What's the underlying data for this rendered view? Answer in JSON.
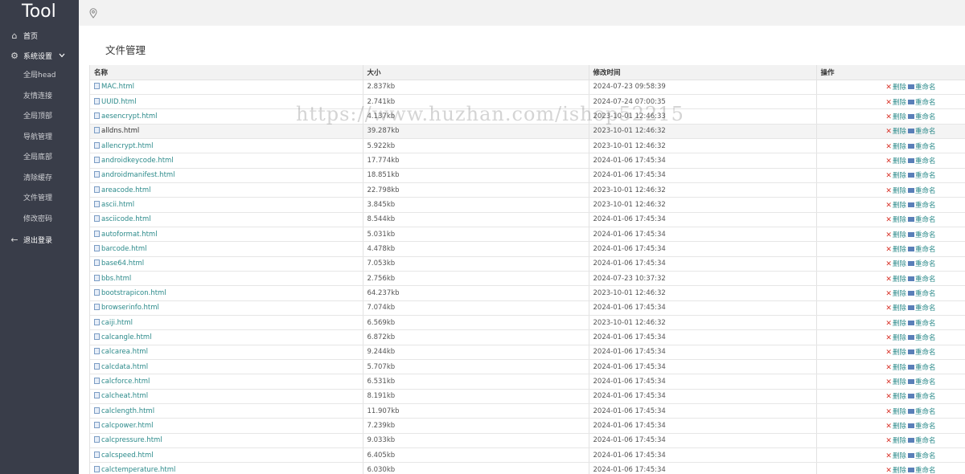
{
  "app": {
    "logo": "Tool"
  },
  "sidebar": {
    "home": {
      "label": "首页",
      "icon": "home-icon"
    },
    "settings": {
      "label": "系统设置",
      "icon": "gear-icon"
    },
    "items": [
      {
        "label": "全局head"
      },
      {
        "label": "友情连接"
      },
      {
        "label": "全局顶部"
      },
      {
        "label": "导航管理"
      },
      {
        "label": "全局底部"
      },
      {
        "label": "清除缓存"
      },
      {
        "label": "文件管理"
      },
      {
        "label": "修改密码"
      }
    ],
    "logout": {
      "label": "退出登录",
      "icon": "arrow-left-icon"
    }
  },
  "page": {
    "title": "文件管理"
  },
  "table": {
    "headers": [
      "名称",
      "大小",
      "修改时间",
      "操作"
    ],
    "delete_label": "删除",
    "rename_label": "重命名",
    "rows": [
      {
        "name": "MAC.html",
        "size": "2.837kb",
        "time": "2024-07-23 09:58:39"
      },
      {
        "name": "UUID.html",
        "size": "2.741kb",
        "time": "2024-07-24 07:00:35"
      },
      {
        "name": "aesencrypt.html",
        "size": "4.137kb",
        "time": "2023-10-01 12:46:33"
      },
      {
        "name": "alldns.html",
        "size": "39.287kb",
        "time": "2023-10-01 12:46:32"
      },
      {
        "name": "allencrypt.html",
        "size": "5.922kb",
        "time": "2023-10-01 12:46:32"
      },
      {
        "name": "androidkeycode.html",
        "size": "17.774kb",
        "time": "2024-01-06 17:45:34"
      },
      {
        "name": "androidmanifest.html",
        "size": "18.851kb",
        "time": "2024-01-06 17:45:34"
      },
      {
        "name": "areacode.html",
        "size": "22.798kb",
        "time": "2023-10-01 12:46:32"
      },
      {
        "name": "ascii.html",
        "size": "3.845kb",
        "time": "2023-10-01 12:46:32"
      },
      {
        "name": "asciicode.html",
        "size": "8.544kb",
        "time": "2024-01-06 17:45:34"
      },
      {
        "name": "autoformat.html",
        "size": "5.031kb",
        "time": "2024-01-06 17:45:34"
      },
      {
        "name": "barcode.html",
        "size": "4.478kb",
        "time": "2024-01-06 17:45:34"
      },
      {
        "name": "base64.html",
        "size": "7.053kb",
        "time": "2024-01-06 17:45:34"
      },
      {
        "name": "bbs.html",
        "size": "2.756kb",
        "time": "2024-07-23 10:37:32"
      },
      {
        "name": "bootstrapicon.html",
        "size": "64.237kb",
        "time": "2023-10-01 12:46:32"
      },
      {
        "name": "browserinfo.html",
        "size": "7.074kb",
        "time": "2024-01-06 17:45:34"
      },
      {
        "name": "caiji.html",
        "size": "6.569kb",
        "time": "2023-10-01 12:46:32"
      },
      {
        "name": "calcangle.html",
        "size": "6.872kb",
        "time": "2024-01-06 17:45:34"
      },
      {
        "name": "calcarea.html",
        "size": "9.244kb",
        "time": "2024-01-06 17:45:34"
      },
      {
        "name": "calcdata.html",
        "size": "5.707kb",
        "time": "2024-01-06 17:45:34"
      },
      {
        "name": "calcforce.html",
        "size": "6.531kb",
        "time": "2024-01-06 17:45:34"
      },
      {
        "name": "calcheat.html",
        "size": "8.191kb",
        "time": "2024-01-06 17:45:34"
      },
      {
        "name": "calclength.html",
        "size": "11.907kb",
        "time": "2024-01-06 17:45:34"
      },
      {
        "name": "calcpower.html",
        "size": "7.239kb",
        "time": "2024-01-06 17:45:34"
      },
      {
        "name": "calcpressure.html",
        "size": "9.033kb",
        "time": "2024-01-06 17:45:34"
      },
      {
        "name": "calcspeed.html",
        "size": "6.405kb",
        "time": "2024-01-06 17:45:34"
      },
      {
        "name": "calctemperature.html",
        "size": "6.030kb",
        "time": "2024-01-06 17:45:34"
      }
    ]
  },
  "watermark": "https://www.huzhan.com/ishop52215"
}
